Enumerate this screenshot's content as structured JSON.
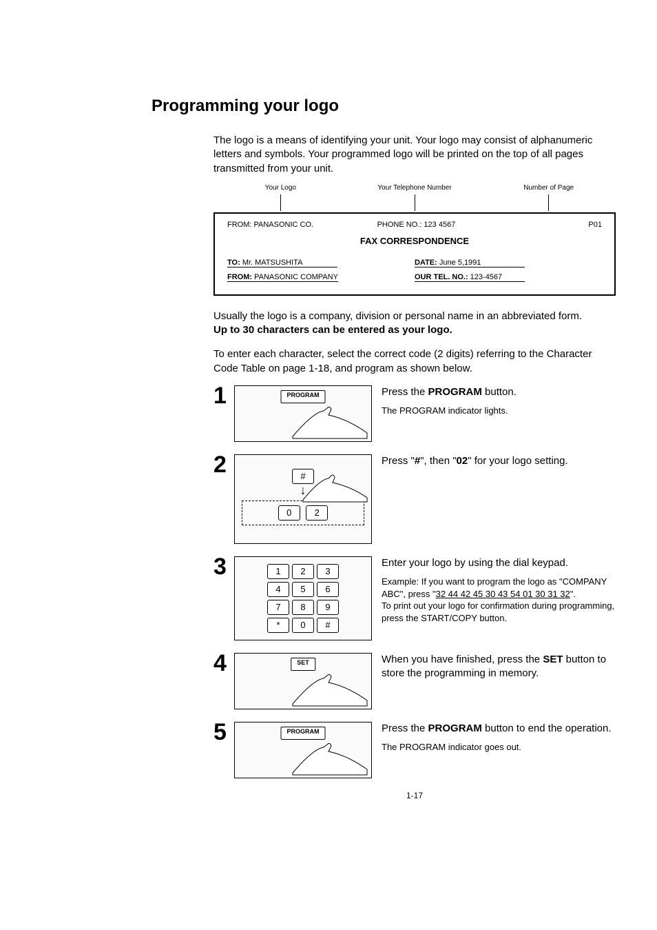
{
  "title": "Programming your logo",
  "intro": "The logo is a means of identifying your unit. Your logo may consist of alphanumeric letters and symbols. Your programmed logo will be printed on the top of all pages transmitted from your unit.",
  "fax_header_labels": {
    "logo": "Your Logo",
    "phone": "Your Telephone Number",
    "page": "Number of Page"
  },
  "fax_sample": {
    "from_top": "FROM: PANASONIC CO.",
    "phone_top": "PHONE NO.: 123 4567",
    "page_top": "P01",
    "title": "FAX CORRESPONDENCE",
    "to_label": "TO:",
    "to_value": "Mr. MATSUSHITA",
    "date_label": "DATE:",
    "date_value": "June 5,1991",
    "from_label": "FROM:",
    "from_value": "PANASONIC COMPANY",
    "tel_label": "OUR TEL. NO.:",
    "tel_value": "123-4567"
  },
  "para1_a": "Usually the logo is a company, division or personal name in an abbreviated form.",
  "para1_b": "Up to 30 characters can be entered as your logo.",
  "para2": "To enter each character, select the correct code (2 digits) referring to the Character Code Table on page 1-18, and program as shown below.",
  "steps": {
    "s1": {
      "num": "1",
      "btn": "PROGRAM",
      "line1_a": "Press the ",
      "line1_b": "PROGRAM",
      "line1_c": " button.",
      "line2": "The PROGRAM indicator lights."
    },
    "s2": {
      "num": "2",
      "key_hash": "#",
      "key_0": "0",
      "key_2": "2",
      "line1_a": "Press \"",
      "line1_b": "#",
      "line1_c": "\", then \"",
      "line1_d": "02",
      "line1_e": "\" for your logo setting."
    },
    "s3": {
      "num": "3",
      "keys": [
        "1",
        "2",
        "3",
        "4",
        "5",
        "6",
        "7",
        "8",
        "9",
        "*",
        "0",
        "#"
      ],
      "line1": "Enter your logo by using the dial keypad.",
      "ex_a": "Example: If you want to program the logo as \"COMPANY ABC\", press \"",
      "ex_b": "32 44 42 45 30 43 54 01 30 31 32",
      "ex_c": "\".",
      "line3": "To print out your logo for confirmation during programming, press the START/COPY button."
    },
    "s4": {
      "num": "4",
      "btn": "SET",
      "line1_a": "When you have finished, press the ",
      "line1_b": "SET",
      "line1_c": " button to store the programming in memory."
    },
    "s5": {
      "num": "5",
      "btn": "PROGRAM",
      "line1_a": "Press the ",
      "line1_b": "PROGRAM",
      "line1_c": " button to end the operation.",
      "line2": "The PROGRAM indicator goes out."
    }
  },
  "page_number": "1-17"
}
